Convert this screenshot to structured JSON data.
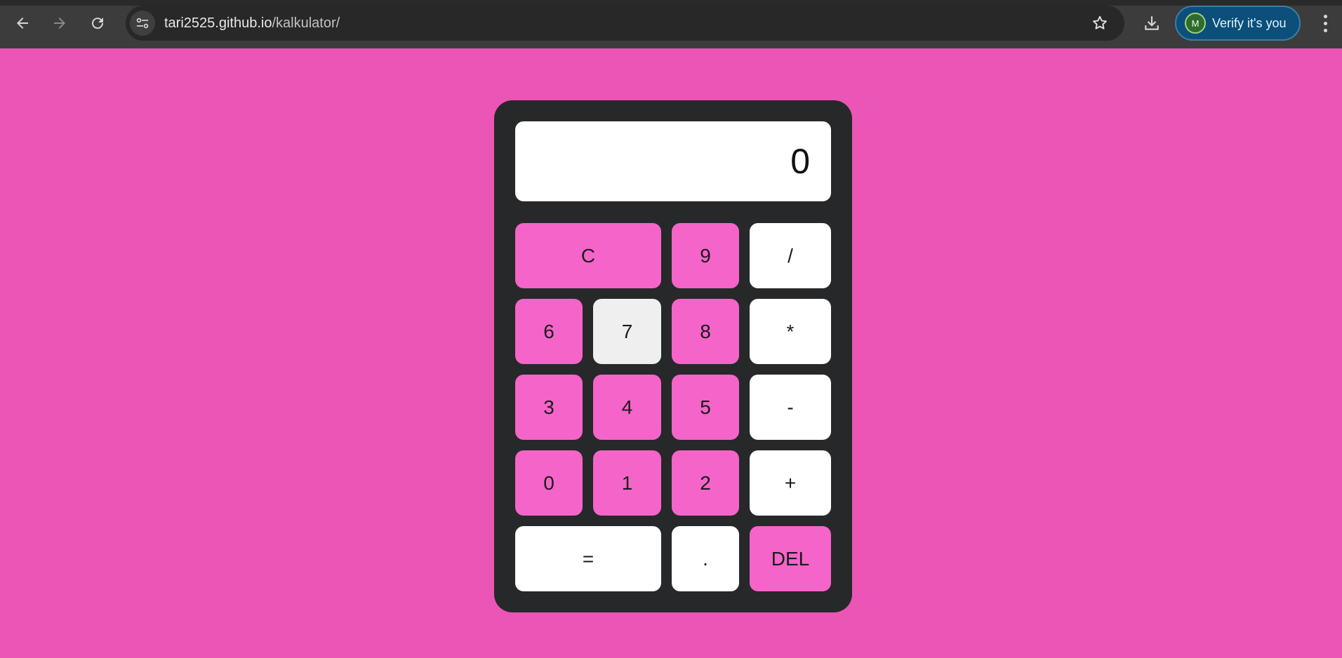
{
  "browser": {
    "url_host": "tari2525.github.io",
    "url_path": "/kalkulator/",
    "verify_label": "Verify it's you",
    "avatar_initial": "M",
    "icons": [
      "back-arrow-icon",
      "forward-arrow-icon",
      "reload-icon",
      "tune-icon",
      "star-icon",
      "download-icon",
      "more-vert-icon"
    ]
  },
  "calculator": {
    "display_value": "0",
    "keys": {
      "clear": "C",
      "nine": "9",
      "divide": "/",
      "six": "6",
      "seven": "7",
      "eight": "8",
      "multiply": "*",
      "three": "3",
      "four": "4",
      "five": "5",
      "subtract": "-",
      "zero": "0",
      "one": "1",
      "two": "2",
      "add": "+",
      "equals": "=",
      "decimal": ".",
      "delete": "DEL"
    }
  },
  "colors": {
    "page_background": "#eb55b5",
    "calculator_body": "#272829",
    "pink_key": "#f564c9",
    "white_key": "#ffffff"
  }
}
